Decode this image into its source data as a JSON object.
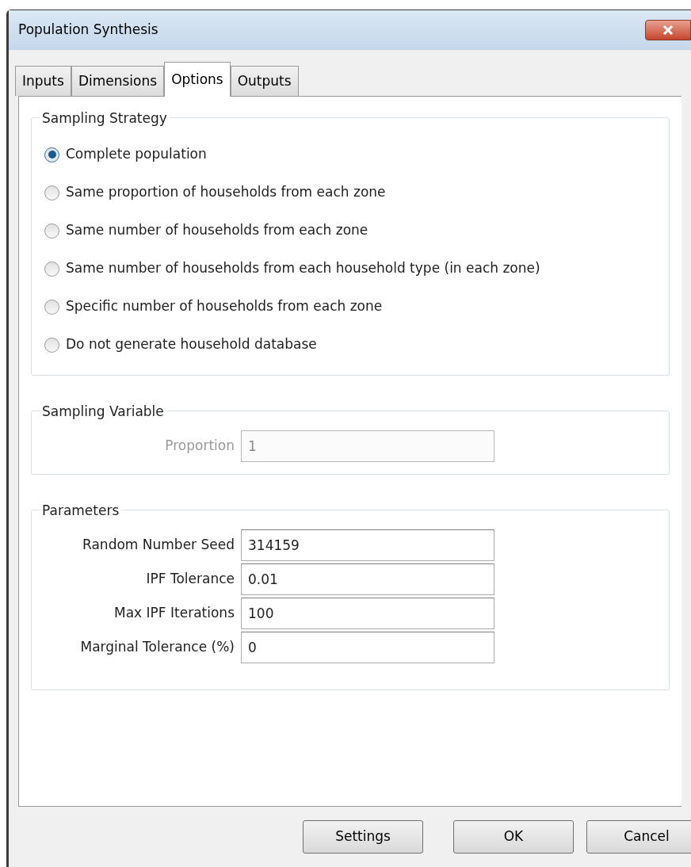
{
  "window": {
    "title": "Population Synthesis"
  },
  "tabs": [
    {
      "label": "Inputs",
      "selected": false
    },
    {
      "label": "Dimensions",
      "selected": false
    },
    {
      "label": "Options",
      "selected": true
    },
    {
      "label": "Outputs",
      "selected": false
    }
  ],
  "sampling_strategy": {
    "title": "Sampling Strategy",
    "options": [
      {
        "label": "Complete population",
        "selected": true
      },
      {
        "label": "Same proportion of households from each zone",
        "selected": false
      },
      {
        "label": "Same number of households from each zone",
        "selected": false
      },
      {
        "label": "Same number of households from each household type (in each zone)",
        "selected": false
      },
      {
        "label": "Specific number of households from each zone",
        "selected": false
      },
      {
        "label": "Do not generate household database",
        "selected": false
      }
    ]
  },
  "sampling_variable": {
    "title": "Sampling Variable",
    "fields": [
      {
        "label": "Proportion",
        "value": "1",
        "disabled": true
      }
    ]
  },
  "parameters": {
    "title": "Parameters",
    "fields": [
      {
        "label": "Random Number Seed",
        "value": "314159",
        "disabled": false
      },
      {
        "label": "IPF Tolerance",
        "value": "0.01",
        "disabled": false
      },
      {
        "label": "Max IPF Iterations",
        "value": "100",
        "disabled": false
      },
      {
        "label": "Marginal Tolerance (%)",
        "value": "0",
        "disabled": false
      }
    ]
  },
  "buttons": [
    "Settings",
    "OK",
    "Cancel"
  ]
}
